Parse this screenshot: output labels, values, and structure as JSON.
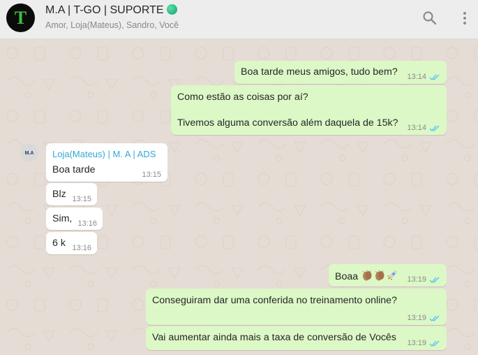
{
  "header": {
    "title": "M.A | T-GO | SUPORTE",
    "participants": "Amor, Loja(Mateus), Sandro, Você",
    "avatar_letter": "T",
    "icons": [
      "search-icon",
      "menu-icon"
    ]
  },
  "messages": {
    "m1": {
      "text": "Boa tarde meus amigos, tudo bem?",
      "time": "13:14"
    },
    "m2": {
      "line1": "Como estão as coisas por aí?",
      "line2": "Tivemos alguma conversão além daquela de 15k?",
      "time": "13:14"
    },
    "m3": {
      "sender": "Loja(Mateus) | M. A | ADS",
      "text": "Boa tarde",
      "time": "13:15",
      "avatar_text": "M.A"
    },
    "m4": {
      "text": "Blz",
      "time": "13:15"
    },
    "m5": {
      "text": "Sim,",
      "time": "13:16"
    },
    "m6": {
      "text": "6 k",
      "time": "13:16"
    },
    "m7": {
      "text": "Boaa",
      "time": "13:19",
      "emojis": [
        "clapping-hands",
        "clapping-hands",
        "rocket"
      ]
    },
    "m8": {
      "text": "Conseguiram dar uma conferida no treinamento online?",
      "time": "13:19"
    },
    "m9": {
      "text": "Vai aumentar ainda mais a taxa de conversão de Vocês",
      "time": "13:19"
    }
  },
  "colors": {
    "outgoing_bubble": "#dcf8c6",
    "incoming_bubble": "#ffffff",
    "chat_background": "#e5ddd5",
    "read_ticks": "#4fc3f7",
    "sender_name": "#35a7d6"
  }
}
